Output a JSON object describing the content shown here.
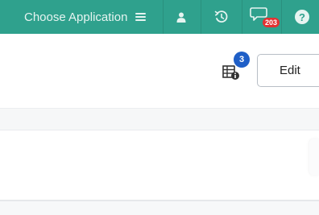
{
  "topbar": {
    "app_switcher_label": "Choose Application",
    "notification_count": "203",
    "help_glyph": "?",
    "icons": [
      "menu-icon",
      "user-icon",
      "history-icon",
      "notifications-icon",
      "help-icon"
    ],
    "background_color": "#2fa18d"
  },
  "toolbar": {
    "table_info_icon": "table-info-icon",
    "badge_count": "3",
    "badge_color": "#1f5fc7",
    "edit_label": "Edit"
  }
}
